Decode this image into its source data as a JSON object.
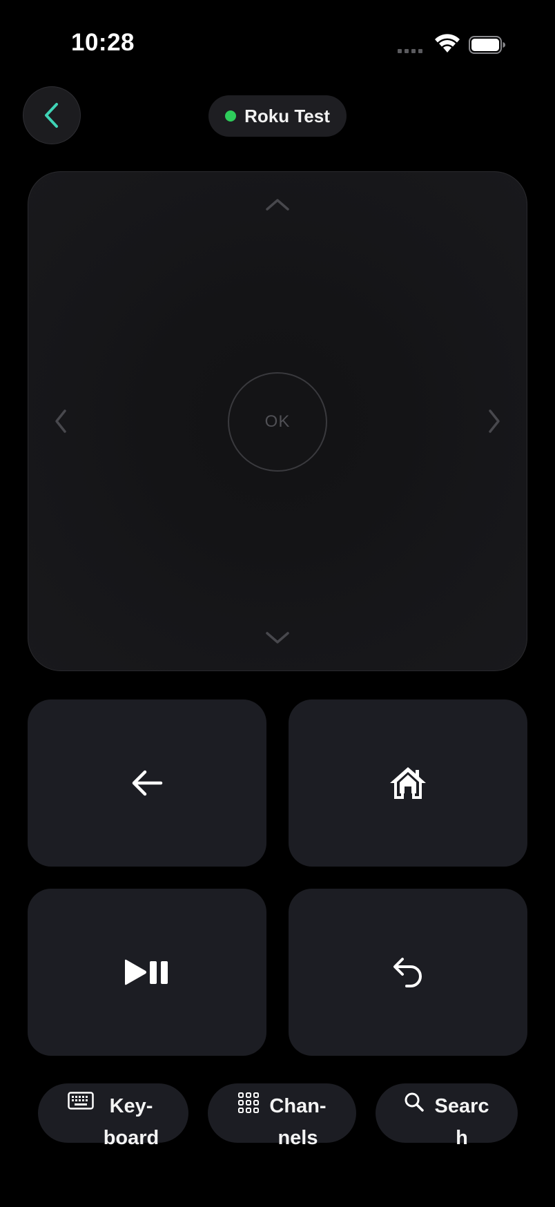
{
  "status_bar": {
    "time": "10:28"
  },
  "header": {
    "device_name": "Roku Test",
    "connection_status_color": "#2ecc5b",
    "accent_color": "#3fd3b5"
  },
  "dpad": {
    "ok_label": "OK"
  },
  "controls": {
    "back_icon": "arrow-left-icon",
    "home_icon": "home-icon",
    "play_pause_icon": "play-pause-icon",
    "replay_icon": "replay-icon"
  },
  "bottom_bar": {
    "keyboard_label": "Key-\nboard",
    "channels_label": "Chan-\nnels",
    "search_label": "Searc\nh"
  }
}
